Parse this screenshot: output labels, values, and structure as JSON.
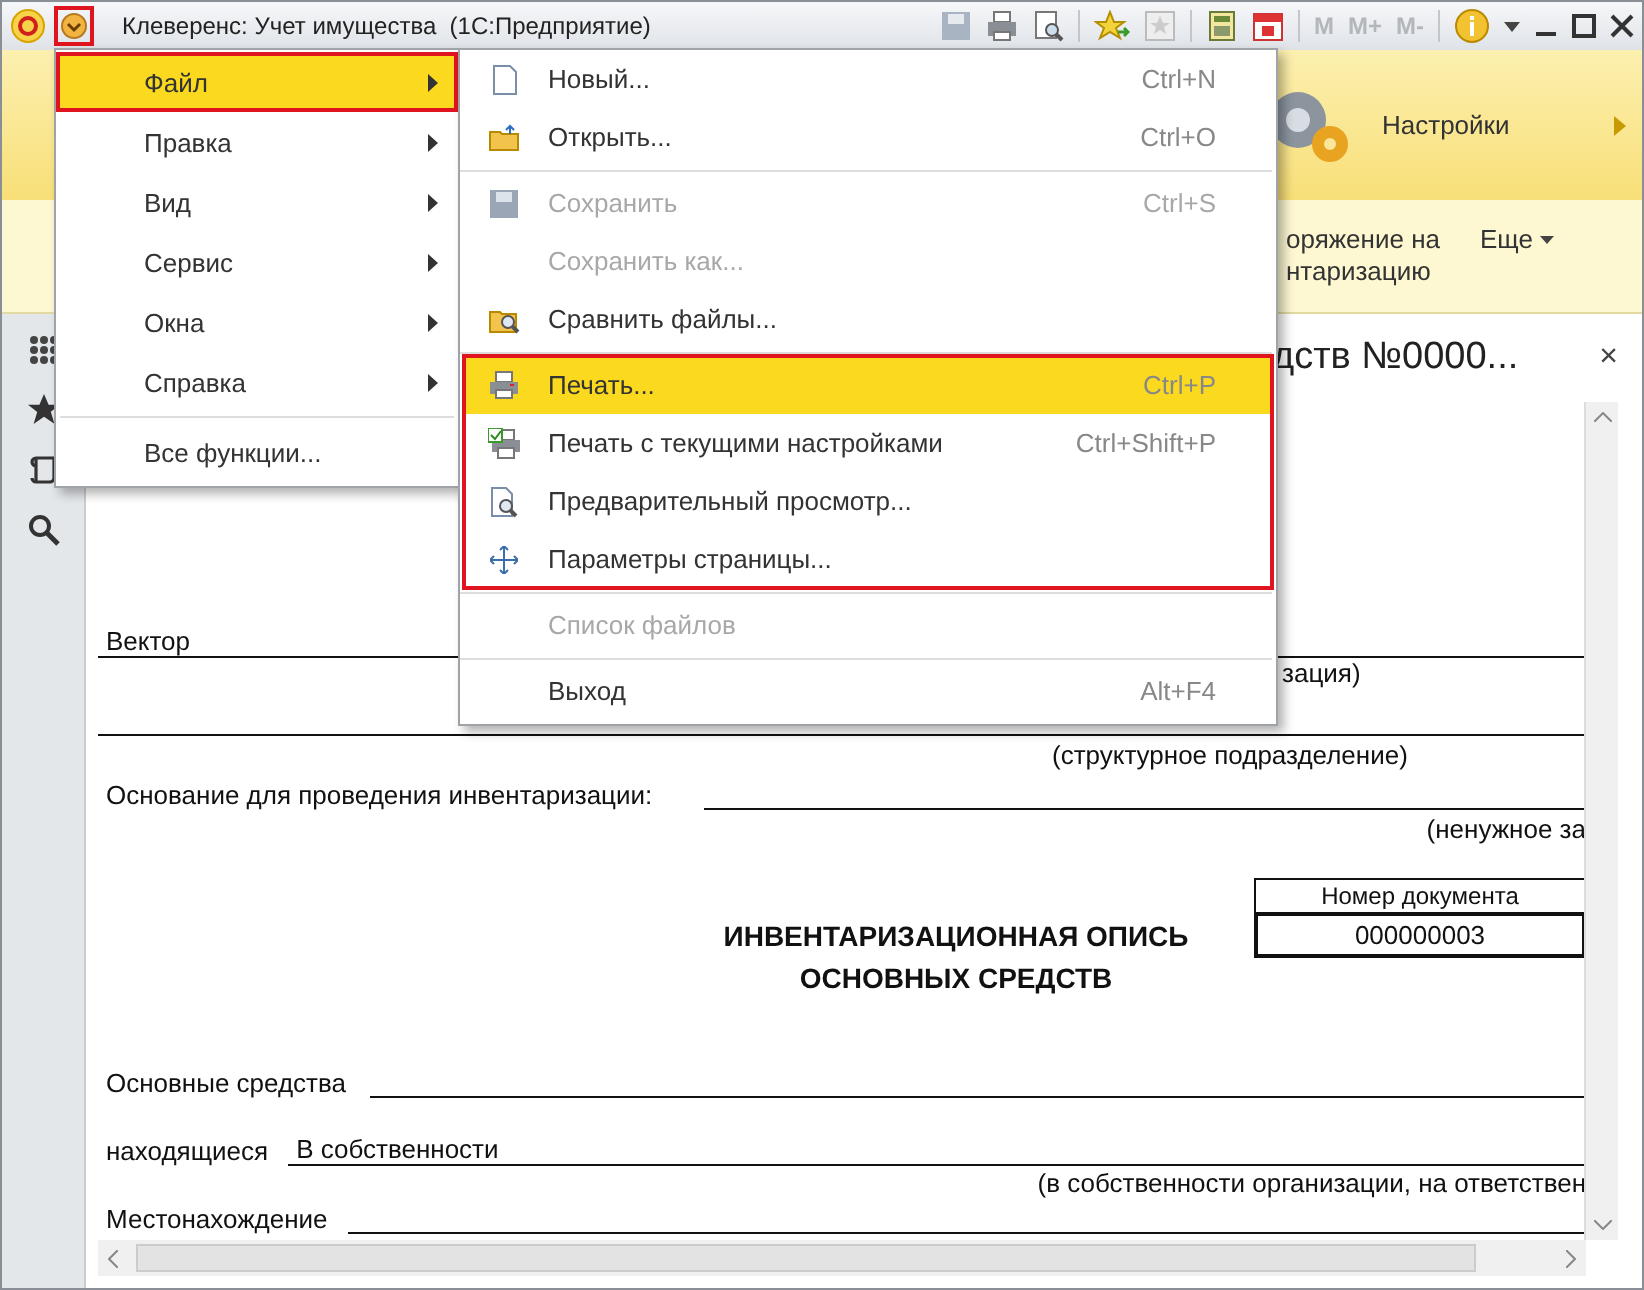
{
  "window": {
    "title": "Клеверенс: Учет имущества  (1С:Предприятие)",
    "menu_button_outlined": true,
    "memory_buttons": [
      "M",
      "M+",
      "M-"
    ]
  },
  "section_bar": {
    "settings": "Настройки"
  },
  "command_bar": {
    "command_button": {
      "lines": [
        "оряжение на",
        "нтаризацию"
      ]
    },
    "more": "Еще"
  },
  "document": {
    "title": "дств №0000...",
    "close": "×"
  },
  "form": {
    "org_name": "Вектор",
    "org_caption": "зация)",
    "dept_caption": "(структурное подразделение)",
    "basis_label": "Основание для проведения инвентаризации:",
    "basis_caption": "(ненужное за",
    "doc_number_label": "Номер документа",
    "doc_number": "000000003",
    "heading": [
      "ИНВЕНТАРИЗАЦИОННАЯ ОПИСЬ",
      "ОСНОВНЫХ СРЕДСТВ"
    ],
    "assets_label": "Основные средства",
    "located_label": "находящиеся",
    "located_value": "В собственности",
    "located_caption": "(в собственности организации, на ответствен",
    "location_label": "Местонахождение"
  },
  "main_menu": {
    "groups": [
      {
        "items": [
          {
            "label": "Файл",
            "submenu": true,
            "selected": true,
            "outlined": true
          },
          {
            "label": "Правка",
            "submenu": true,
            "selected": false,
            "outlined": false
          },
          {
            "label": "Вид",
            "submenu": true,
            "selected": false,
            "outlined": false
          },
          {
            "label": "Сервис",
            "submenu": true,
            "selected": false,
            "outlined": false
          },
          {
            "label": "Окна",
            "submenu": true,
            "selected": false,
            "outlined": false
          },
          {
            "label": "Справка",
            "submenu": true,
            "selected": false,
            "outlined": false
          }
        ]
      },
      {
        "items": [
          {
            "label": "Все функции...",
            "submenu": false,
            "selected": false,
            "outlined": false
          }
        ]
      }
    ]
  },
  "file_menu": {
    "groups": [
      {
        "outlined": false,
        "items": [
          {
            "label": "Новый...",
            "shortcut": "Ctrl+N",
            "kind": "document",
            "disabled": false,
            "selected": false
          },
          {
            "label": "Открыть...",
            "shortcut": "Ctrl+O",
            "kind": "folder",
            "disabled": false,
            "selected": false
          }
        ]
      },
      {
        "outlined": false,
        "items": [
          {
            "label": "Сохранить",
            "shortcut": "Ctrl+S",
            "kind": "disk",
            "disabled": true,
            "selected": false
          },
          {
            "label": "Сохранить как...",
            "kind": "plain",
            "disabled": true,
            "selected": false
          },
          {
            "label": "Сравнить файлы...",
            "kind": "compare",
            "disabled": false,
            "selected": false
          }
        ]
      },
      {
        "outlined": true,
        "items": [
          {
            "label": "Печать...",
            "shortcut": "Ctrl+P",
            "kind": "printer",
            "disabled": false,
            "selected": true
          },
          {
            "label": "Печать с текущими настройками",
            "shortcut": "Ctrl+Shift+P",
            "kind": "printer-check",
            "disabled": false,
            "selected": false
          },
          {
            "label": "Предварительный просмотр...",
            "kind": "preview",
            "disabled": false,
            "selected": false
          },
          {
            "label": "Параметры страницы...",
            "kind": "crosshair",
            "disabled": false,
            "selected": false
          }
        ]
      },
      {
        "outlined": false,
        "items": [
          {
            "label": "Список файлов",
            "kind": "plain",
            "disabled": true,
            "selected": false
          }
        ]
      },
      {
        "outlined": false,
        "items": [
          {
            "label": "Выход",
            "shortcut": "Alt+F4",
            "kind": "plain",
            "disabled": false,
            "selected": false
          }
        ]
      }
    ]
  }
}
